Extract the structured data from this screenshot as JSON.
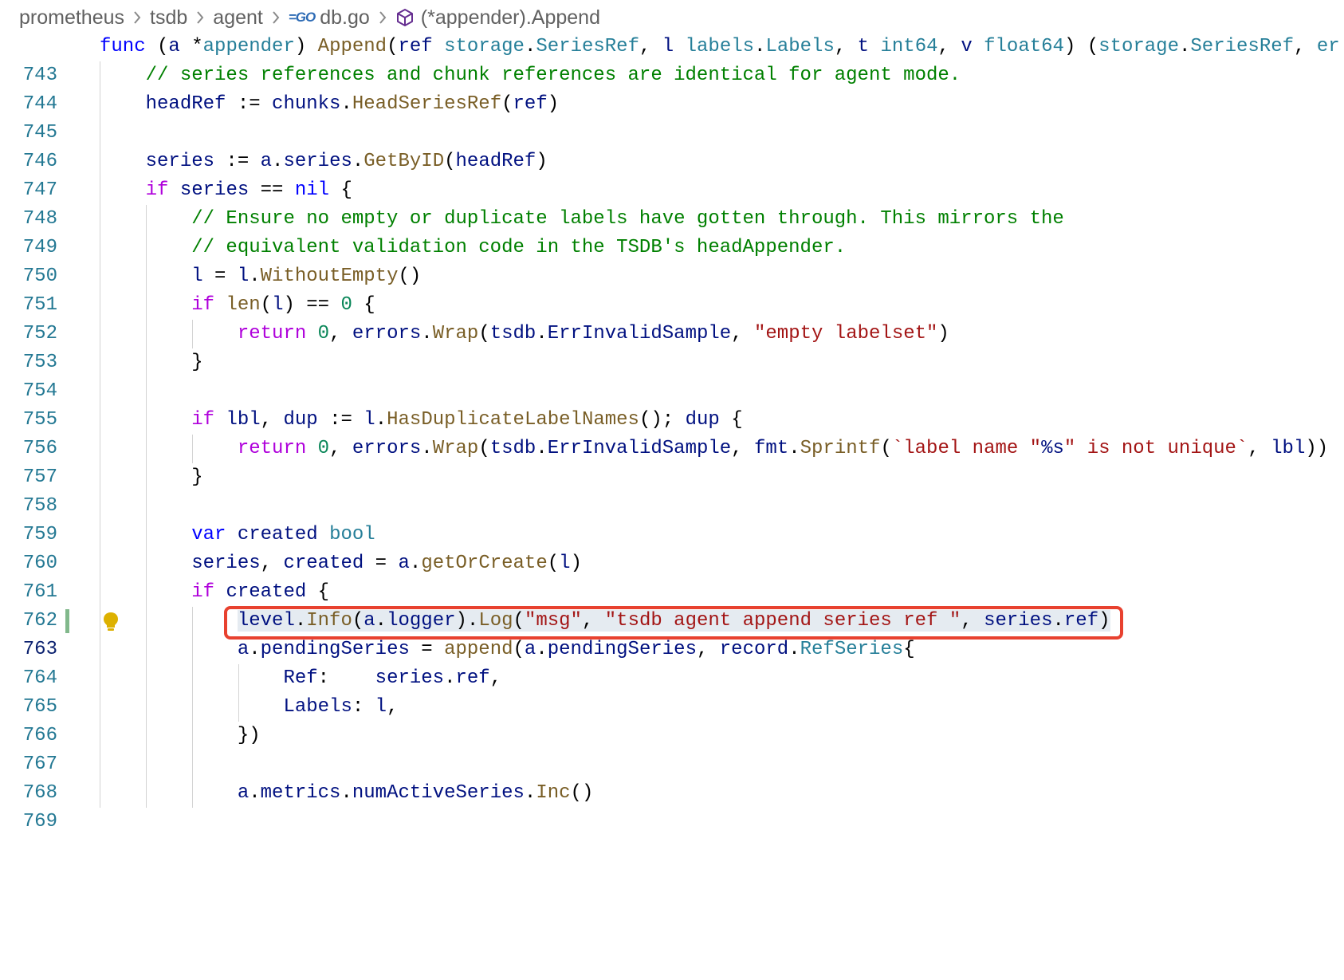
{
  "breadcrumb": {
    "items": [
      "prometheus",
      "tsdb",
      "agent",
      "db.go",
      "(*appender).Append"
    ],
    "separator": ">"
  },
  "icons": {
    "file_icon": "go-file-icon",
    "symbol_icon": "method-cube-icon",
    "code_action": "lightbulb-icon"
  },
  "editor": {
    "line_numbers": [
      "743",
      "744",
      "745",
      "746",
      "747",
      "748",
      "749",
      "750",
      "751",
      "752",
      "753",
      "754",
      "755",
      "756",
      "757",
      "758",
      "759",
      "760",
      "761",
      "762",
      "763",
      "764",
      "765",
      "766",
      "767",
      "768",
      "769"
    ],
    "active_line": "763",
    "highlighted_text": "level.Info(a.logger).Log(\"msg\", \"tsdb agent append series ref \", series.ref)",
    "colors": {
      "keyword": "#0000ff",
      "control": "#af00db",
      "variable": "#001080",
      "function": "#795e26",
      "type": "#267f99",
      "string": "#a31515",
      "number": "#098658",
      "comment": "#008000",
      "line_number": "#237893",
      "highlight_border": "#e8412f",
      "modified_gutter": "#81b88b"
    }
  }
}
